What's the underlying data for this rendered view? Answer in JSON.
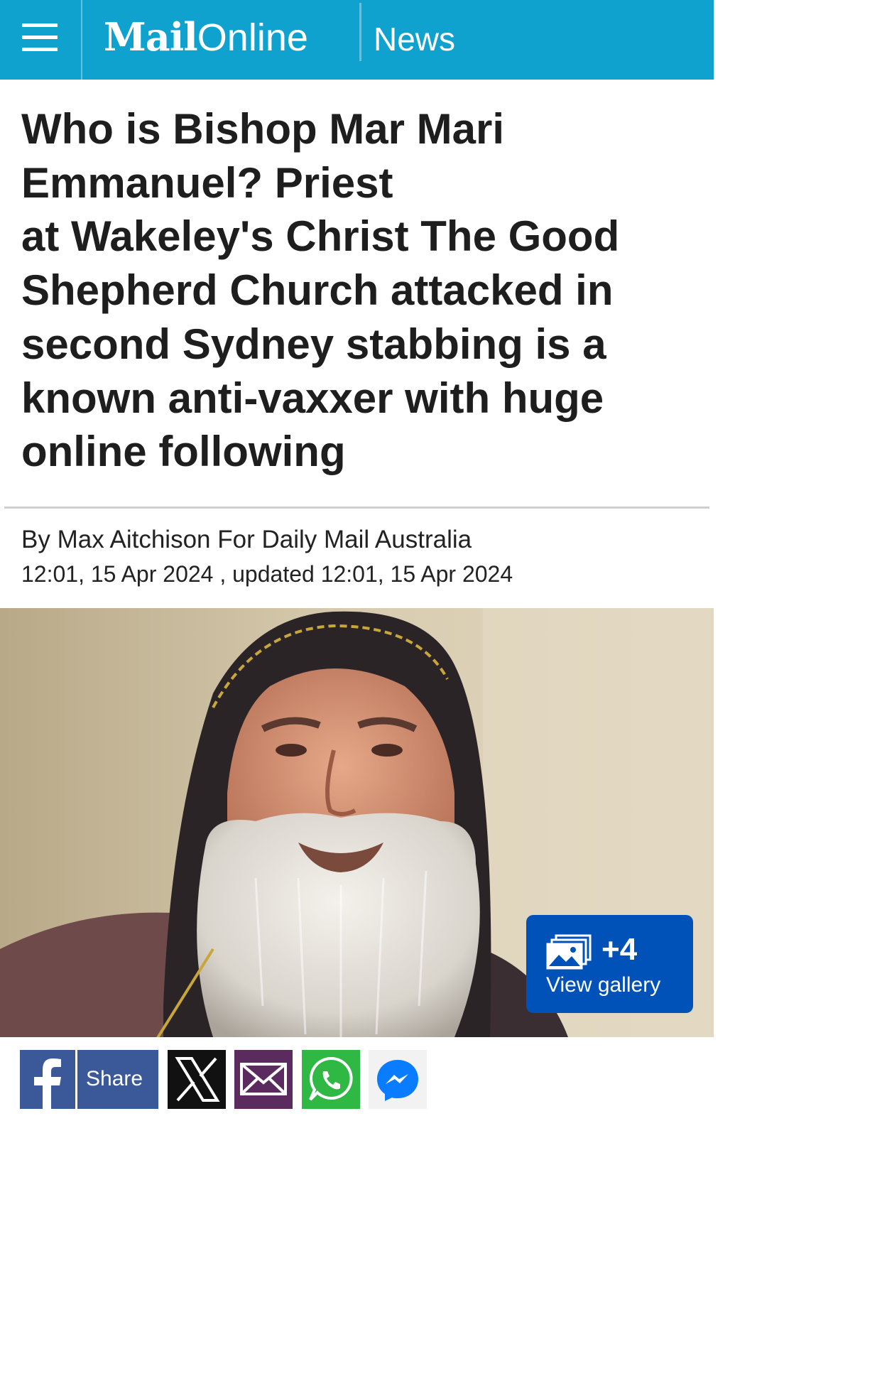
{
  "header": {
    "logo_mail": "Mail",
    "logo_online": "Online",
    "section": "News"
  },
  "article": {
    "headline_lines": [
      "Who is Bishop Mar Mari",
      "Emmanuel? Priest",
      "at Wakeley's Christ The Good",
      "Shepherd Church attacked in",
      "second Sydney stabbing is a",
      "known anti-vaxxer with huge",
      "online following"
    ],
    "byline": "By Max Aitchison For Daily Mail Australia",
    "dateline": "12:01, 15 Apr 2024 , updated 12:01, 15 Apr 2024"
  },
  "gallery": {
    "count": "+4",
    "label": "View gallery"
  },
  "share": {
    "facebook_label": "Share",
    "icons": [
      "facebook-icon",
      "x-icon",
      "email-icon",
      "whatsapp-icon",
      "messenger-icon"
    ]
  },
  "colors": {
    "header_bg": "#0fa2cf",
    "gallery_bg": "#0052b8",
    "facebook": "#3b5998",
    "x": "#111111",
    "email": "#5b2a5e",
    "whatsapp": "#2fb844",
    "messenger": "#0a7cff"
  }
}
